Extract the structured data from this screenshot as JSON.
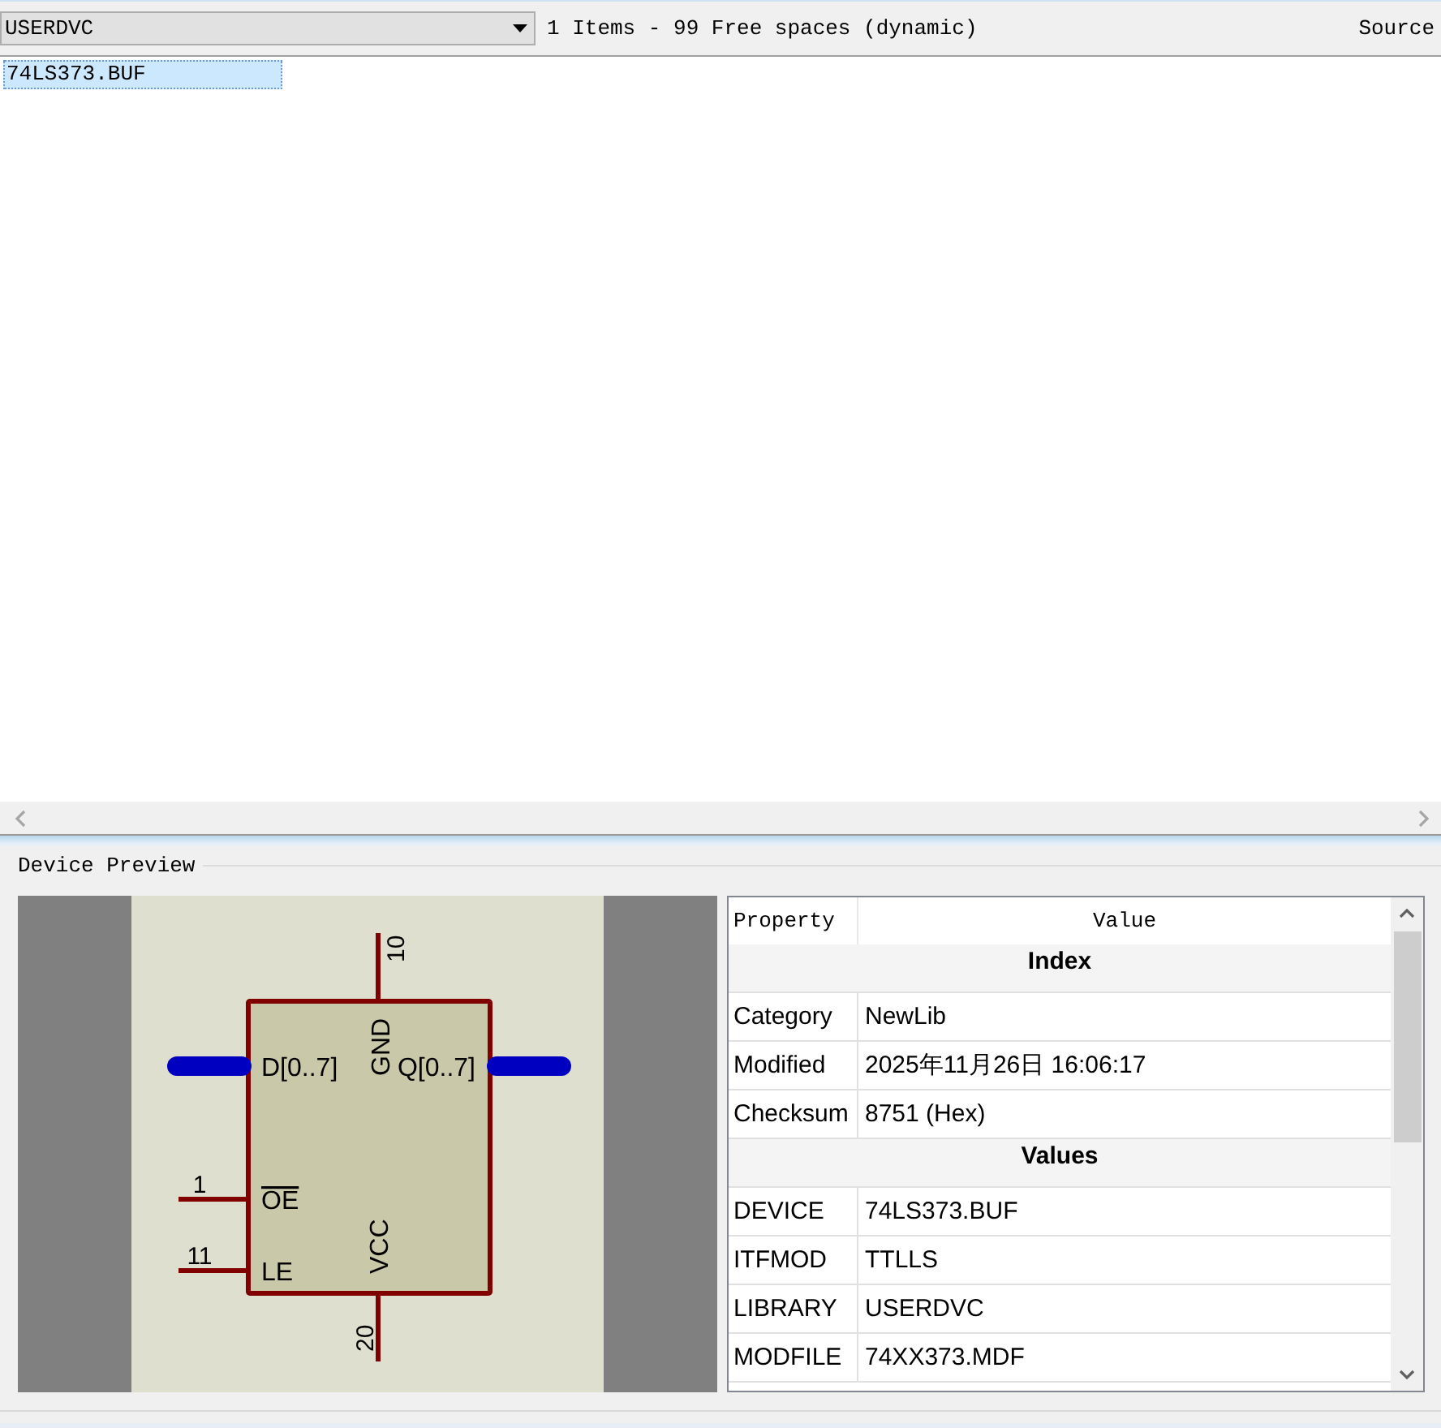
{
  "toolbar": {
    "library_dropdown": {
      "value": "USERDVC"
    },
    "summary": "1 Items - 99 Free spaces (dynamic)",
    "column_header": "Source"
  },
  "device_list": {
    "items": [
      {
        "label": "74LS373.BUF",
        "selected": true
      }
    ]
  },
  "preview": {
    "title": "Device Preview",
    "schematic": {
      "pins": [
        {
          "kind": "power",
          "name": "GND",
          "number": "10"
        },
        {
          "kind": "bus",
          "name": "D[0..7]"
        },
        {
          "kind": "bus",
          "name": "Q[0..7]"
        },
        {
          "kind": "pin",
          "name": "OE",
          "number": "1",
          "inverted": true
        },
        {
          "kind": "pin",
          "name": "LE",
          "number": "11",
          "inverted": false
        },
        {
          "kind": "power",
          "name": "VCC",
          "number": "20"
        }
      ]
    },
    "properties": {
      "columns": [
        "Property",
        "Value"
      ],
      "sections": [
        {
          "title": "Index",
          "rows": [
            {
              "property": "Category",
              "value": "NewLib"
            },
            {
              "property": "Modified",
              "value": "2025年11月26日 16:06:17"
            },
            {
              "property": "Checksum",
              "value": "8751 (Hex)"
            }
          ]
        },
        {
          "title": "Values",
          "rows": [
            {
              "property": "DEVICE",
              "value": "74LS373.BUF"
            },
            {
              "property": "ITFMOD",
              "value": "TTLLS"
            },
            {
              "property": "LIBRARY",
              "value": "USERDVC"
            },
            {
              "property": "MODFILE",
              "value": "74XX373.MDF"
            }
          ]
        }
      ]
    }
  }
}
